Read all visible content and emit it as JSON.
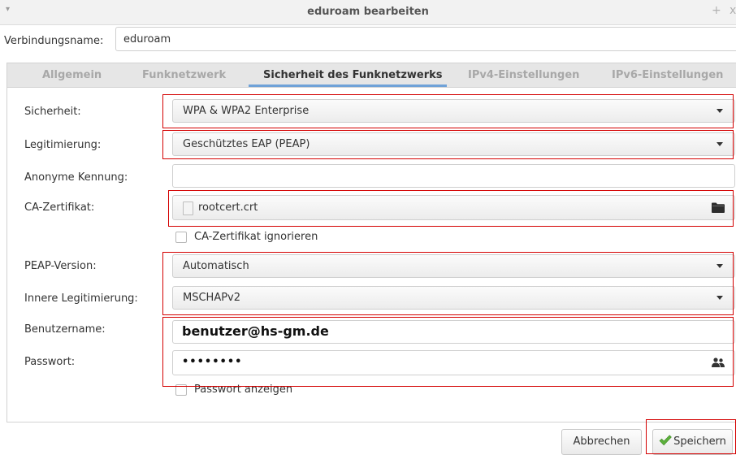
{
  "window": {
    "title": "eduroam bearbeiten",
    "menu_glyph": "▾",
    "maximize_glyph": "+",
    "close_glyph": "x"
  },
  "connection": {
    "label": "Verbindungsname:",
    "value": "eduroam"
  },
  "tabs": [
    {
      "label": "Allgemein",
      "active": false
    },
    {
      "label": "Funknetzwerk",
      "active": false
    },
    {
      "label": "Sicherheit des Funknetzwerks",
      "active": true
    },
    {
      "label": "IPv4-Einstellungen",
      "active": false
    },
    {
      "label": "IPv6-Einstellungen",
      "active": false
    }
  ],
  "form": {
    "security": {
      "label": "Sicherheit:",
      "value": "WPA & WPA2 Enterprise"
    },
    "authentication": {
      "label": "Legitimierung:",
      "value": "Geschütztes EAP (PEAP)"
    },
    "anonymous_identity": {
      "label": "Anonyme Kennung:",
      "value": ""
    },
    "ca_certificate": {
      "label": "CA-Zertifikat:",
      "file": "rootcert.crt",
      "icon": "folder-icon"
    },
    "ignore_ca": {
      "label": "CA-Zertifikat ignorieren",
      "checked": false
    },
    "peap_version": {
      "label": "PEAP-Version:",
      "value": "Automatisch"
    },
    "inner_auth": {
      "label": "Innere Legitimierung:",
      "value": "MSCHAPv2"
    },
    "username": {
      "label": "Benutzername:",
      "value": "benutzer@hs-gm.de"
    },
    "password": {
      "label": "Passwort:",
      "value": "••••••••",
      "icon": "people-icon"
    },
    "show_password": {
      "label": "Passwort anzeigen",
      "checked": false
    }
  },
  "buttons": {
    "cancel": "Abbrechen",
    "save": "Speichern"
  },
  "colors": {
    "highlight": "#d40000",
    "active_tab_underline": "#6fa2d8",
    "save_check": "#5cb03b"
  }
}
